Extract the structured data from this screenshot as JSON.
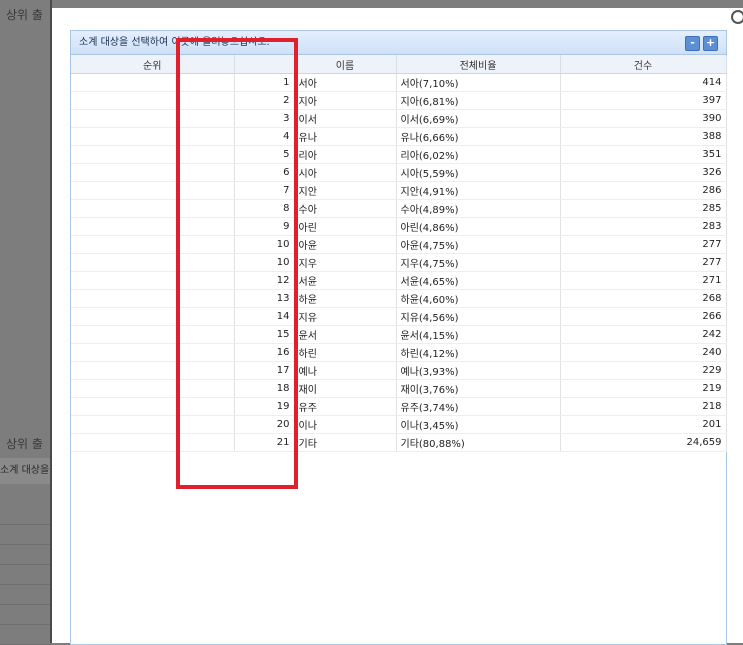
{
  "background": {
    "title_top": "상위 출",
    "title_lower": "상위 출",
    "strip_text": "소계 대상을"
  },
  "panel": {
    "header_text": "소계 대상을 선택하여 이곳에 올려놓으십시오.",
    "collapse_label": "-",
    "expand_label": "+"
  },
  "table": {
    "columns": [
      "순위",
      "",
      "이름",
      "전체비율",
      "건수"
    ],
    "rows": [
      {
        "rank": "1",
        "name": "서아",
        "ratio": "서아(7,10%)",
        "count": "414"
      },
      {
        "rank": "2",
        "name": "지아",
        "ratio": "지아(6,81%)",
        "count": "397"
      },
      {
        "rank": "3",
        "name": "이서",
        "ratio": "이서(6,69%)",
        "count": "390"
      },
      {
        "rank": "4",
        "name": "유나",
        "ratio": "유나(6,66%)",
        "count": "388"
      },
      {
        "rank": "5",
        "name": "리아",
        "ratio": "리아(6,02%)",
        "count": "351"
      },
      {
        "rank": "6",
        "name": "시아",
        "ratio": "시아(5,59%)",
        "count": "326"
      },
      {
        "rank": "7",
        "name": "지안",
        "ratio": "지안(4,91%)",
        "count": "286"
      },
      {
        "rank": "8",
        "name": "수아",
        "ratio": "수아(4,89%)",
        "count": "285"
      },
      {
        "rank": "9",
        "name": "아린",
        "ratio": "아린(4,86%)",
        "count": "283"
      },
      {
        "rank": "10",
        "name": "아윤",
        "ratio": "아윤(4,75%)",
        "count": "277"
      },
      {
        "rank": "10",
        "name": "지우",
        "ratio": "지우(4,75%)",
        "count": "277"
      },
      {
        "rank": "12",
        "name": "서윤",
        "ratio": "서윤(4,65%)",
        "count": "271"
      },
      {
        "rank": "13",
        "name": "하윤",
        "ratio": "하윤(4,60%)",
        "count": "268"
      },
      {
        "rank": "14",
        "name": "지유",
        "ratio": "지유(4,56%)",
        "count": "266"
      },
      {
        "rank": "15",
        "name": "윤서",
        "ratio": "윤서(4,15%)",
        "count": "242"
      },
      {
        "rank": "16",
        "name": "하린",
        "ratio": "하린(4,12%)",
        "count": "240"
      },
      {
        "rank": "17",
        "name": "예나",
        "ratio": "예나(3,93%)",
        "count": "229"
      },
      {
        "rank": "18",
        "name": "재이",
        "ratio": "재이(3,76%)",
        "count": "219"
      },
      {
        "rank": "19",
        "name": "유주",
        "ratio": "유주(3,74%)",
        "count": "218"
      },
      {
        "rank": "20",
        "name": "이나",
        "ratio": "이나(3,45%)",
        "count": "201"
      },
      {
        "rank": "21",
        "name": "기타",
        "ratio": "기타(80,88%)",
        "count": "24,659"
      }
    ]
  },
  "colors": {
    "highlight": "#e0202c",
    "header_bg": "#dbe8fb",
    "border": "#a9c6e4"
  }
}
